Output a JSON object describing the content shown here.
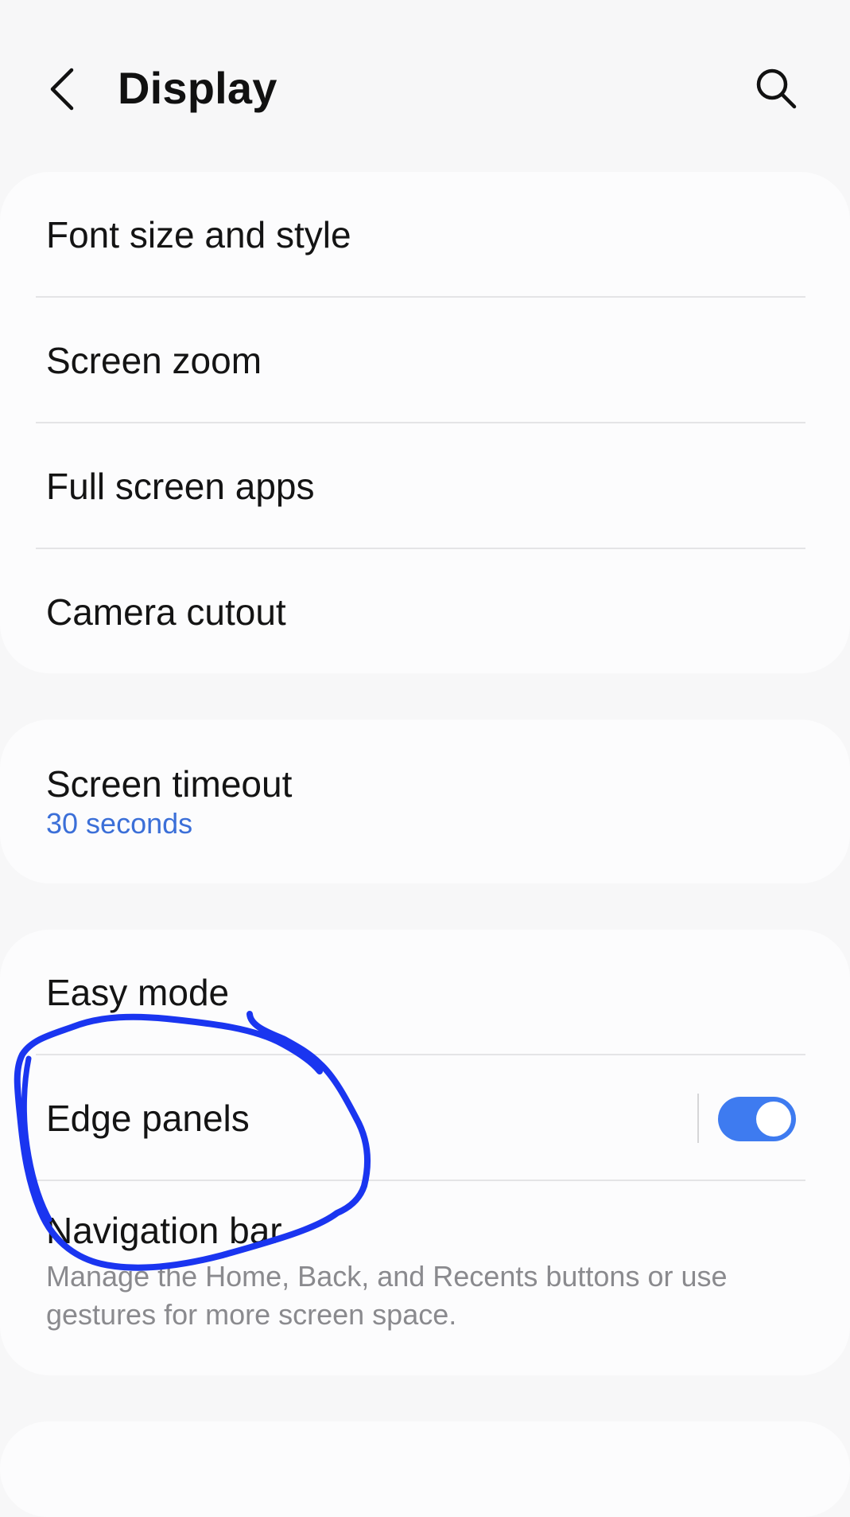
{
  "header": {
    "title": "Display",
    "back_icon": "chevron-left-icon",
    "search_icon": "search-icon"
  },
  "card1": {
    "items": [
      {
        "label": "Font size and style"
      },
      {
        "label": "Screen zoom"
      },
      {
        "label": "Full screen apps"
      },
      {
        "label": "Camera cutout"
      }
    ]
  },
  "card2": {
    "screen_timeout": {
      "label": "Screen timeout",
      "value": "30 seconds"
    }
  },
  "card3": {
    "easy_mode": {
      "label": "Easy mode"
    },
    "edge_panels": {
      "label": "Edge panels",
      "toggle_on": true
    },
    "navigation_bar": {
      "label": "Navigation bar",
      "description": "Manage the Home, Back, and Recents buttons or use gestures for more screen space."
    }
  },
  "colors": {
    "accent": "#3e7bf0",
    "link_blue": "#3b6fd8",
    "annotation_blue": "#1a35f0",
    "background": "#f7f7f8",
    "card": "#fcfcfd"
  }
}
